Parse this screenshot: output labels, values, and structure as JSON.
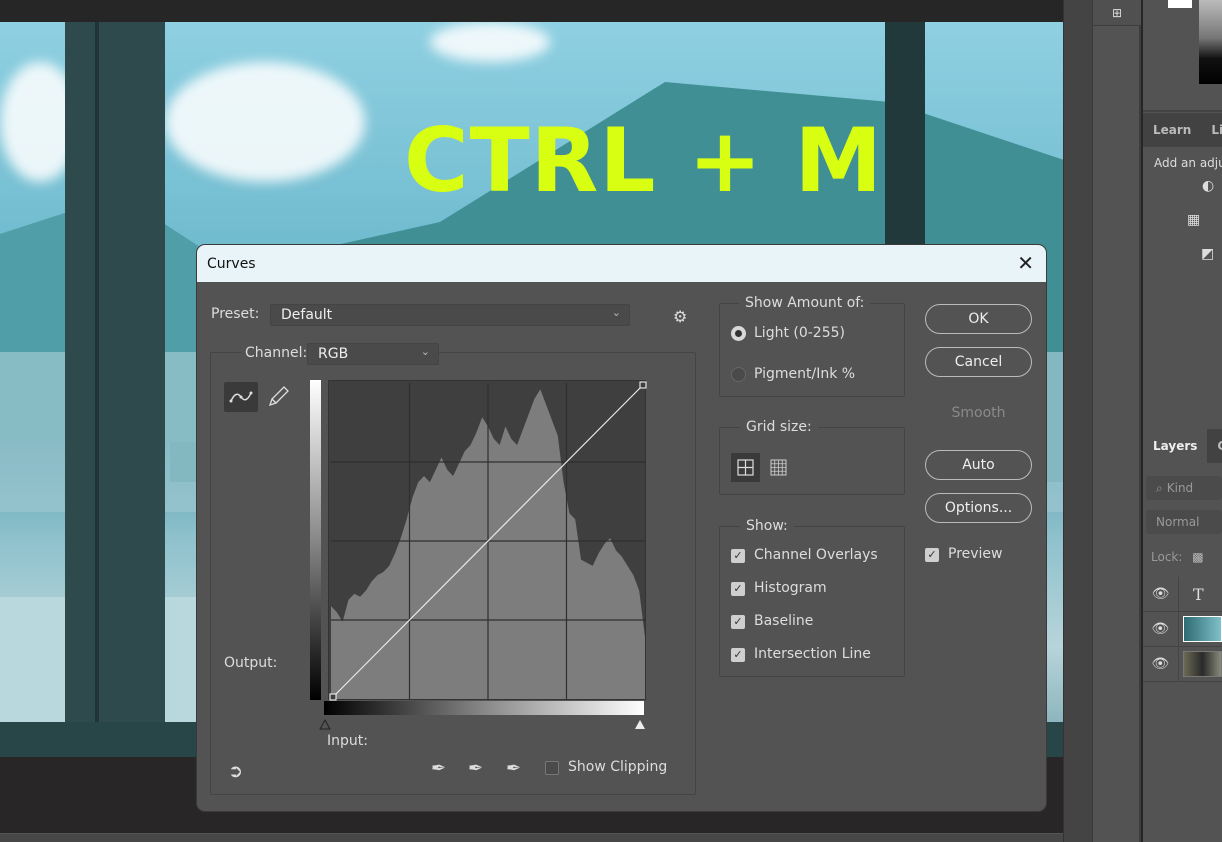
{
  "canvas": {
    "overlay_text": "CTRL + M",
    "overlay_color": "#d8ff12"
  },
  "right_panel": {
    "tabs_top": [
      "Learn",
      "Li"
    ],
    "adjustments_hint": "Add an adju",
    "layers_tabs": [
      "Layers",
      "C"
    ],
    "search_placeholder": "Kind",
    "blend_mode": "Normal",
    "lock_label": "Lock:",
    "layers": [
      {
        "type": "text",
        "visible": true,
        "icon": "T"
      },
      {
        "type": "image",
        "visible": true
      },
      {
        "type": "image",
        "visible": true
      }
    ]
  },
  "dialog": {
    "title": "Curves",
    "close_glyph": "✕",
    "preset": {
      "label": "Preset:",
      "value": "Default"
    },
    "gear_glyph": "⚙",
    "channel": {
      "label": "Channel:",
      "value": "RGB"
    },
    "output_label": "Output:",
    "input_label": "Input:",
    "show_clipping": {
      "label": "Show Clipping",
      "checked": false
    },
    "show_amount": {
      "legend": "Show Amount of:",
      "options": [
        {
          "label": "Light  (0-255)",
          "selected": true
        },
        {
          "label": "Pigment/Ink %",
          "selected": false
        }
      ]
    },
    "grid_size": {
      "legend": "Grid size:",
      "selected": "simple"
    },
    "show": {
      "legend": "Show:",
      "options": [
        {
          "label": "Channel Overlays",
          "checked": true
        },
        {
          "label": "Histogram",
          "checked": true
        },
        {
          "label": "Baseline",
          "checked": true
        },
        {
          "label": "Intersection Line",
          "checked": true
        }
      ]
    },
    "buttons": {
      "ok": "OK",
      "cancel": "Cancel",
      "smooth": "Smooth",
      "auto": "Auto",
      "options": "Options..."
    },
    "preview": {
      "label": "Preview",
      "checked": true
    },
    "curve_points": [
      [
        0,
        0
      ],
      [
        255,
        255
      ]
    ],
    "histogram": [
      0.3,
      0.28,
      0.25,
      0.32,
      0.34,
      0.33,
      0.35,
      0.38,
      0.4,
      0.41,
      0.43,
      0.47,
      0.52,
      0.58,
      0.65,
      0.7,
      0.72,
      0.7,
      0.74,
      0.78,
      0.74,
      0.72,
      0.76,
      0.8,
      0.82,
      0.86,
      0.91,
      0.88,
      0.84,
      0.82,
      0.88,
      0.84,
      0.82,
      0.87,
      0.92,
      0.97,
      1.0,
      0.95,
      0.9,
      0.85,
      0.7,
      0.6,
      0.58,
      0.45,
      0.44,
      0.43,
      0.47,
      0.5,
      0.52,
      0.48,
      0.46,
      0.43,
      0.4,
      0.35,
      0.2
    ]
  }
}
